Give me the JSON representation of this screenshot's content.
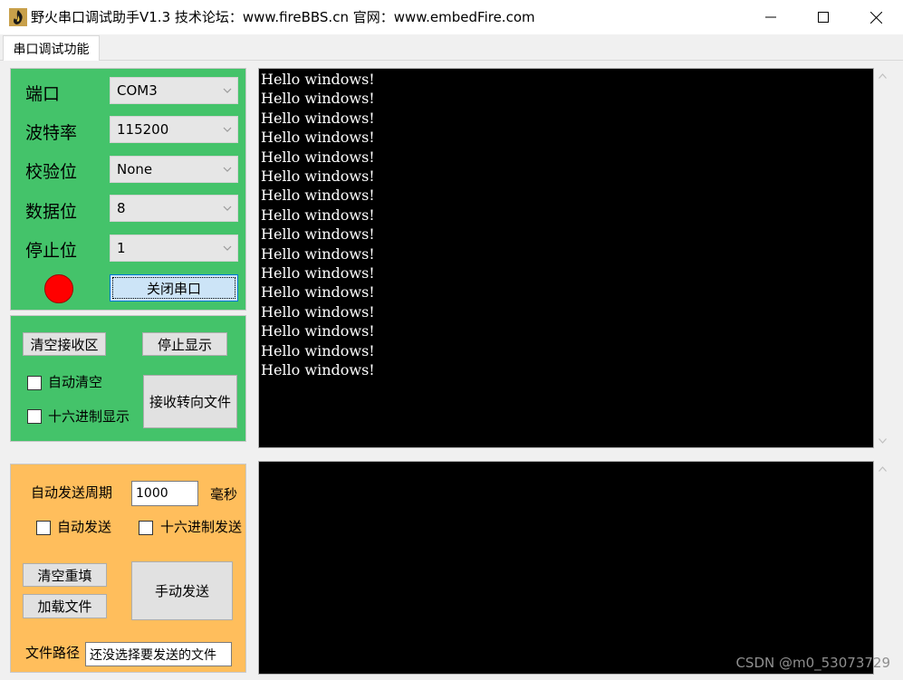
{
  "window": {
    "title": "野火串口调试助手V1.3    技术论坛：www.fireBBS.cn    官网：www.embedFire.com"
  },
  "tabs": [
    {
      "label": "串口调试功能"
    }
  ],
  "serial": {
    "port_label": "端口",
    "port_value": "COM3",
    "baud_label": "波特率",
    "baud_value": "115200",
    "parity_label": "校验位",
    "parity_value": "None",
    "databits_label": "数据位",
    "databits_value": "8",
    "stopbits_label": "停止位",
    "stopbits_value": "1",
    "status_color": "#ff0000",
    "toggle_button": "关闭串口"
  },
  "receive_controls": {
    "clear_button": "清空接收区",
    "stop_button": "停止显示",
    "auto_clear_label": "自动清空",
    "hex_display_label": "十六进制显示",
    "redirect_button": "接收转向文件"
  },
  "send_controls": {
    "period_label": "自动发送周期",
    "period_value": "1000",
    "period_unit": "毫秒",
    "auto_send_label": "自动发送",
    "hex_send_label": "十六进制发送",
    "clear_button": "清空重填",
    "load_button": "加载文件",
    "manual_send_button": "手动发送",
    "file_path_label": "文件路径",
    "file_path_value": "还没选择要发送的文件"
  },
  "receive_area": {
    "lines": [
      "Hello windows!",
      "Hello windows!",
      "Hello windows!",
      "Hello windows!",
      "Hello windows!",
      "Hello windows!",
      "Hello windows!",
      "Hello windows!",
      "Hello windows!",
      "Hello windows!",
      "Hello windows!",
      "Hello windows!",
      "Hello windows!",
      "Hello windows!",
      "Hello windows!",
      "Hello windows!"
    ]
  },
  "watermark": "CSDN @m0_53073729",
  "colors": {
    "serial_panel": "#44c36a",
    "send_panel": "#ffbe5c",
    "console_bg": "#000000",
    "console_text": "#ffffff"
  }
}
